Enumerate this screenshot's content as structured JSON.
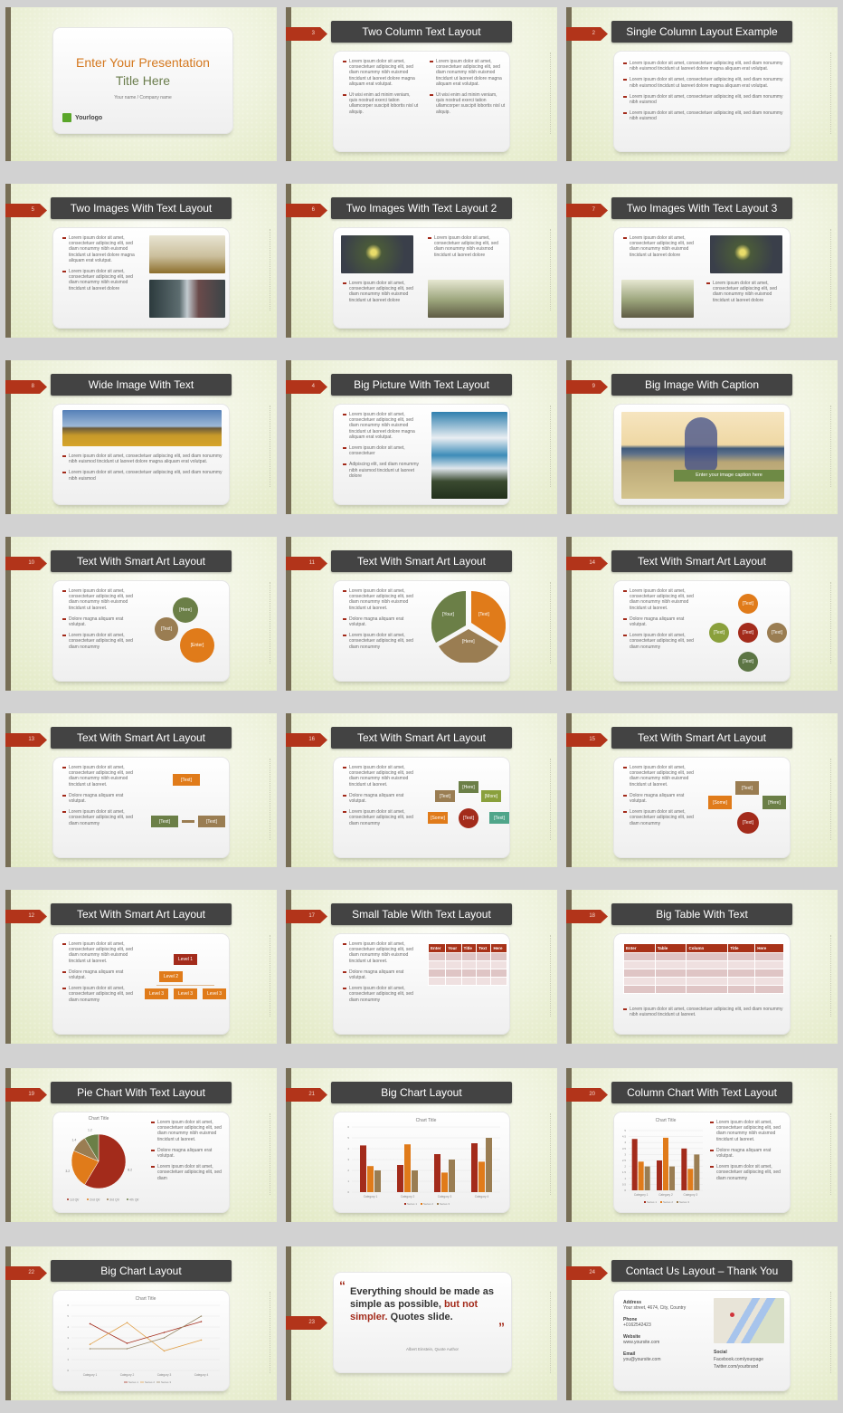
{
  "deck": {
    "name": "Presentation slide template thumbnails"
  },
  "colors": {
    "accent_red": "#b2341a",
    "orange": "#e07b1a",
    "olive": "#6b7f47",
    "brown": "#9a7d52",
    "title_bar": "#434343",
    "side_bar": "#776e55",
    "caption_green": "#6e8a45"
  },
  "lorem": {
    "long": "Lorem ipsum dolor sit amet, consectetuer adipiscing elit, sed diam nonummy nibh euismod tincidunt ut laoreet dolore magna aliquam erat volutpat.",
    "ut": "Ut wisi enim ad minim veniam, quis nostrud exerci tation ullamcorper suscipit lobortis nisl ut aliquip.",
    "short": "Lorem ipsum dolor sit amet, consectetuer adipiscing elit, sed diam nonummy nibh euismod",
    "laoreet": "Lorem ipsum dolor sit amet, consectetuer adipiscing elit, sed diam nonummy nibh euismod tincidunt ut laoreet.",
    "laoreet_dolore": "Lorem ipsum dolor sit amet, consectetuer adipiscing elit, sed diam nonummy nibh euismod tincidunt ut laoreet dolore",
    "dolore": "Dolore magna aliquam erat volutpat.",
    "nonummy": "Lorem ipsum dolor sit amet, consectetuer adipiscing elit, sed diam nonummy",
    "consectetuer": "Lorem ipsum dolor sit amet, consectetuer",
    "adipiscing": "Adipiscing elit, sed diam nonummy nibh euismod tincidunt ut laoreet dolore",
    "pie_1": "Lorem ipsum dolor sit amet, consectetuer adipiscing elit, sed diam nonummy nibh euismod tincidunt ut laoreet.",
    "pie_3": "Lorem ipsum dolor sit amet, consectetuer adipiscing elit, sed diam",
    "col_3": "Lorem ipsum dolor sit amet, consectetuer adipiscing elit, sed diam nonummy"
  },
  "slides": {
    "s1": {
      "title_line1": "Enter Your Presentation",
      "title_line2": "Title Here",
      "subtitle": "Your name / Company name",
      "logo": "Yourlogo"
    },
    "s3": {
      "num": "3",
      "title": "Two Column Text Layout"
    },
    "s2": {
      "num": "2",
      "title": "Single Column Layout Example"
    },
    "s5": {
      "num": "5",
      "title": "Two Images With Text Layout"
    },
    "s6": {
      "num": "6",
      "title": "Two Images With Text Layout 2"
    },
    "s7": {
      "num": "7",
      "title": "Two Images With Text Layout 3"
    },
    "s8": {
      "num": "8",
      "title": "Wide Image With Text"
    },
    "s4": {
      "num": "4",
      "title": "Big Picture With Text Layout"
    },
    "s9": {
      "num": "9",
      "title": "Big Image With Caption",
      "caption": "Enter your image caption here"
    },
    "s10": {
      "num": "10",
      "title": "Text With Smart Art Layout",
      "labels": [
        "[Here]",
        "[Text]",
        "[Enter]"
      ]
    },
    "s11": {
      "num": "11",
      "title": "Text With Smart Art Layout",
      "labels": [
        "[Your]",
        "[Text]",
        "[Here]"
      ]
    },
    "s14": {
      "num": "14",
      "title": "Text With Smart Art Layout",
      "labels": [
        "[Text]",
        "[Text]",
        "[Text]",
        "[Text]",
        "[Text]"
      ]
    },
    "s13": {
      "num": "13",
      "title": "Text With Smart Art Layout",
      "labels": [
        "[Text]",
        "[Text]",
        "[Text]"
      ]
    },
    "s16": {
      "num": "16",
      "title": "Text With Smart Art Layout",
      "labels": [
        "[Text]",
        "[Here]",
        "[More]",
        "[Some]",
        "[Text]",
        "[Text]"
      ]
    },
    "s15": {
      "num": "15",
      "title": "Text With Smart Art Layout",
      "labels": [
        "[Text]",
        "[Some]",
        "[Here]",
        "[Text]"
      ]
    },
    "s12": {
      "num": "12",
      "title": "Text With Smart Art Layout",
      "labels": [
        "Level 1",
        "Level 2",
        "Level 3",
        "Level 3",
        "Level 3"
      ]
    },
    "s17": {
      "num": "17",
      "title": "Small Table With Text Layout",
      "headers": [
        "Enter",
        "Your",
        "Title",
        "Text",
        "Here"
      ]
    },
    "s18": {
      "num": "18",
      "title": "Big Table With Text",
      "headers": [
        "Enter",
        "Table",
        "Column",
        "Title",
        "Here"
      ]
    },
    "s19": {
      "num": "19",
      "title": "Pie Chart With Text Layout"
    },
    "s21": {
      "num": "21",
      "title": "Big Chart Layout"
    },
    "s20": {
      "num": "20",
      "title": "Column Chart With Text Layout"
    },
    "s22": {
      "num": "22",
      "title": "Big Chart Layout"
    },
    "s23": {
      "num": "23",
      "quote_a": "Everything should be made as simple as possible, ",
      "quote_b": "but not simpler.",
      "quote_c": " Quotes slide.",
      "author": "Albert Einstein, Quote Author",
      "open_quote": "“",
      "close_quote": "”"
    },
    "s24": {
      "num": "24",
      "title": "Contact Us Layout – Thank You",
      "address_label": "Address",
      "address": "Your street, 4674, City, Country",
      "phone_label": "Phone",
      "phone": "+0162542423",
      "website_label": "Website",
      "website": "www.yoursite.com",
      "email_label": "Email",
      "email": "you@yoursite.com",
      "social_label": "Social",
      "facebook": "Facebook.com/yourpage",
      "twitter": "Twitter.com/yourbrand"
    }
  },
  "chart_data": [
    {
      "id": "s19",
      "type": "pie",
      "title": "Chart Title",
      "categories": [
        "1st Qtr",
        "2nd Qtr",
        "3rd Qtr",
        "4th Qtr"
      ],
      "values": [
        8.2,
        3.2,
        1.4,
        1.2
      ],
      "legend": "bottom"
    },
    {
      "id": "s21",
      "type": "bar",
      "title": "Chart Title",
      "categories": [
        "Category 1",
        "Category 2",
        "Category 3",
        "Category 4"
      ],
      "series": [
        {
          "name": "Series 1",
          "values": [
            4.3,
            2.5,
            3.5,
            4.5
          ]
        },
        {
          "name": "Series 2",
          "values": [
            2.4,
            4.4,
            1.8,
            2.8
          ]
        },
        {
          "name": "Series 3",
          "values": [
            2,
            2,
            3,
            5
          ]
        }
      ],
      "ylim": [
        0,
        6
      ],
      "yticks": [
        0,
        1,
        2,
        3,
        4,
        5,
        6
      ],
      "legend": "bottom"
    },
    {
      "id": "s20",
      "type": "bar",
      "title": "Chart Title",
      "categories": [
        "Category 1",
        "Category 2",
        "Category 3"
      ],
      "series": [
        {
          "name": "Series 1",
          "values": [
            4.3,
            2.5,
            3.5
          ]
        },
        {
          "name": "Series 2",
          "values": [
            2.4,
            4.4,
            1.8
          ]
        },
        {
          "name": "Series 3",
          "values": [
            2,
            2,
            3
          ]
        }
      ],
      "ylim": [
        0,
        5
      ],
      "yticks": [
        0,
        0.5,
        1,
        1.5,
        2,
        2.5,
        3,
        3.5,
        4,
        4.5,
        5
      ],
      "legend": "bottom"
    },
    {
      "id": "s22",
      "type": "line",
      "title": "Chart Title",
      "categories": [
        "Category 1",
        "Category 2",
        "Category 3",
        "Category 4"
      ],
      "series": [
        {
          "name": "Series 1",
          "values": [
            4.3,
            2.5,
            3.5,
            4.5
          ]
        },
        {
          "name": "Series 2",
          "values": [
            2.4,
            4.4,
            1.8,
            2.8
          ]
        },
        {
          "name": "Series 3",
          "values": [
            2,
            2,
            3,
            5
          ]
        }
      ],
      "ylim": [
        0,
        6
      ],
      "yticks": [
        0,
        1,
        2,
        3,
        4,
        5,
        6
      ],
      "legend": "bottom"
    }
  ]
}
